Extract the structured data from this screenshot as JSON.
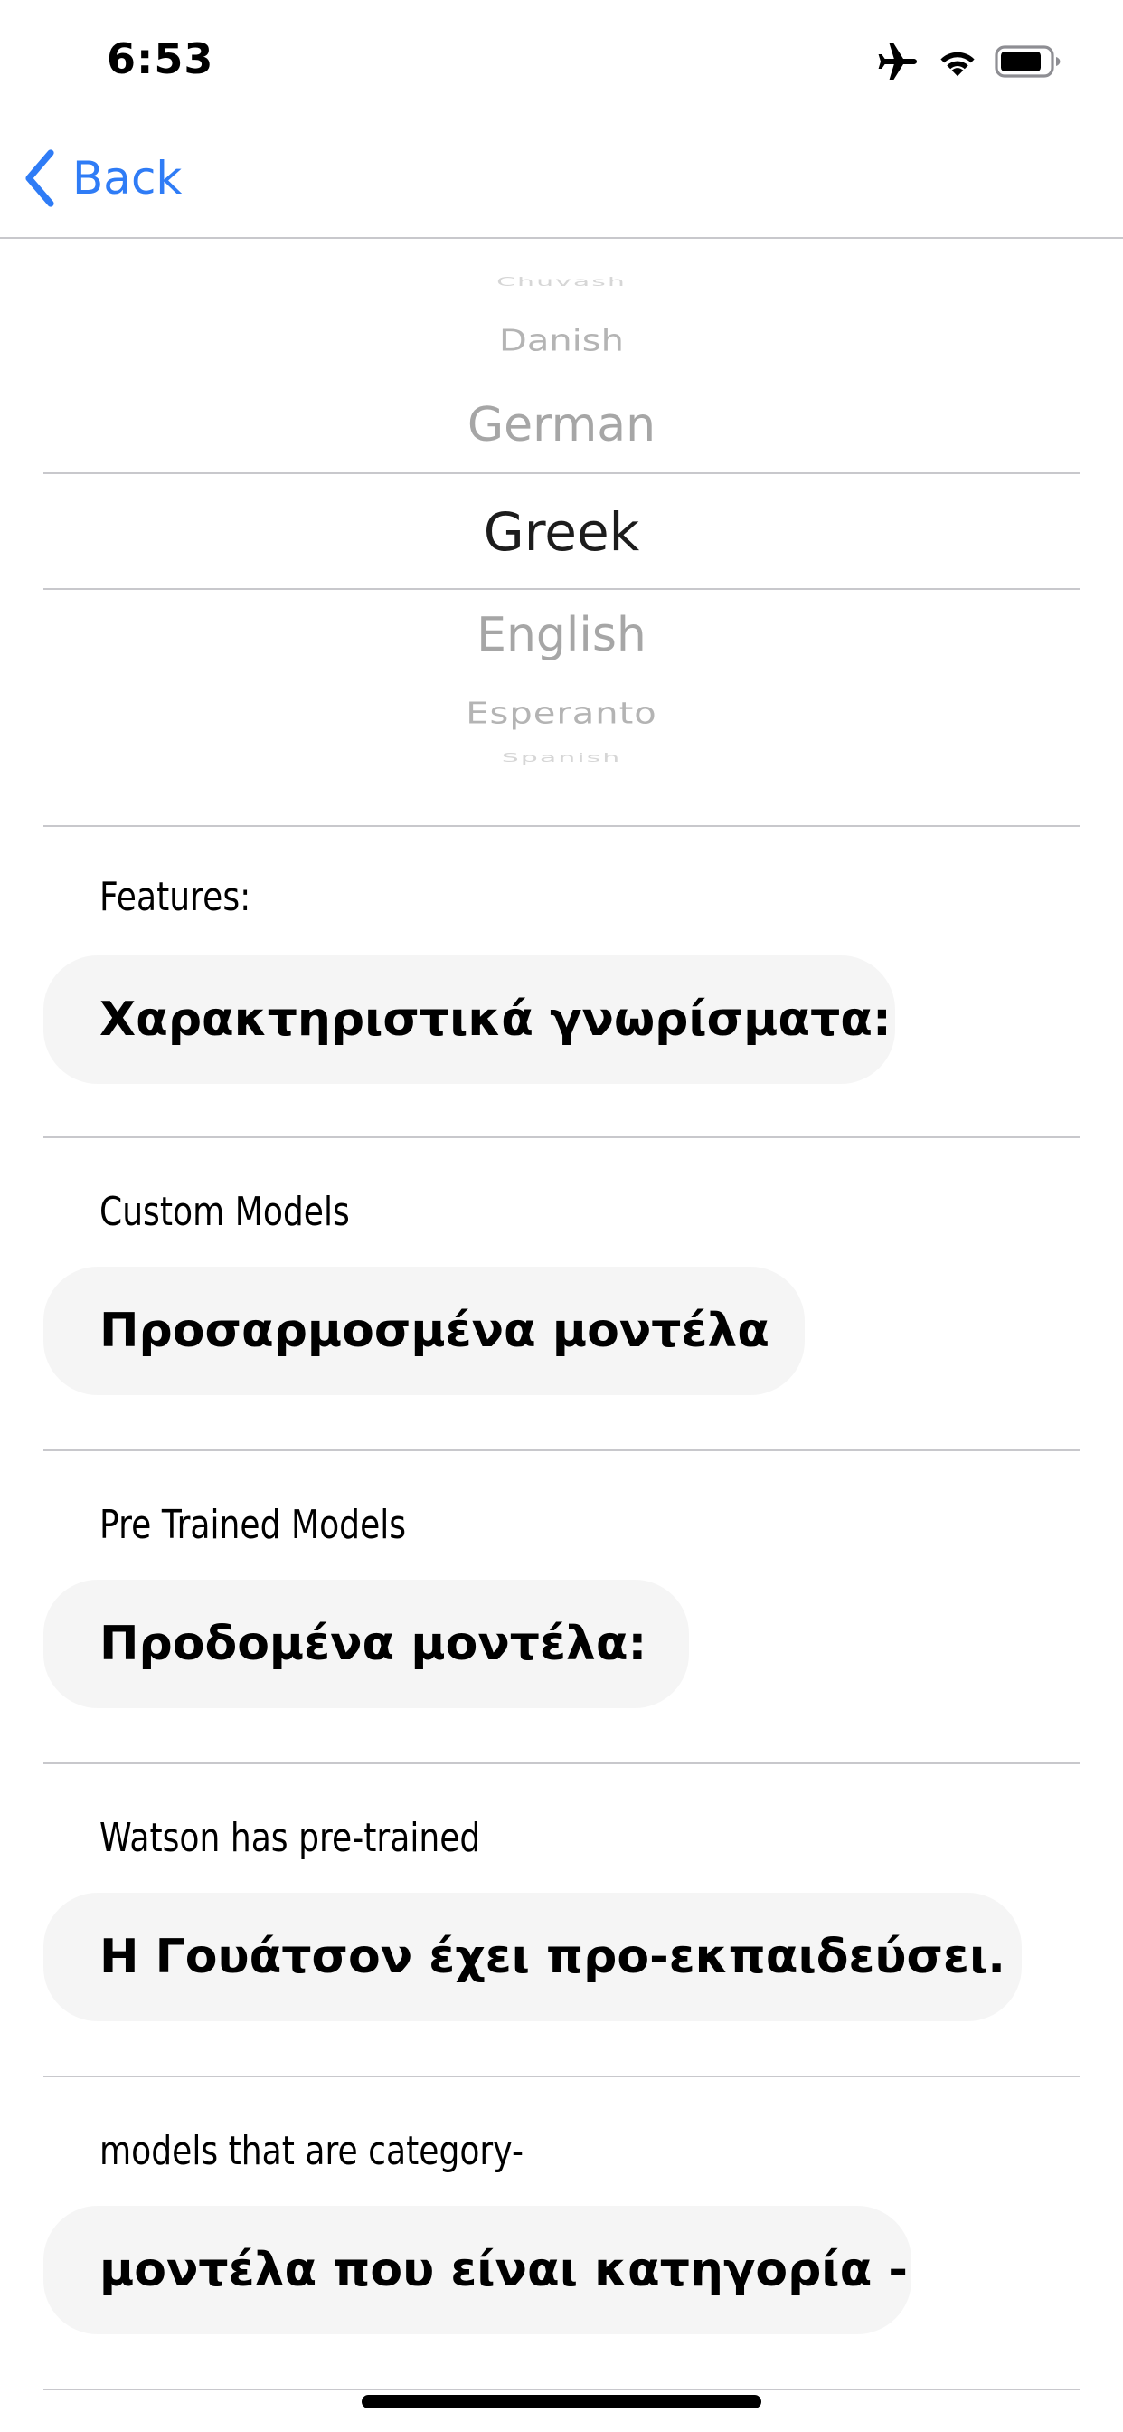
{
  "status_bar": {
    "time": "6:53",
    "icons": [
      "airplane-icon",
      "wifi-icon",
      "battery-icon"
    ]
  },
  "nav": {
    "back_label": "Back",
    "accent_color": "#2f7cf6"
  },
  "picker": {
    "items": [
      "Chuvash",
      "Danish",
      "German",
      "Greek",
      "English",
      "Esperanto",
      "Spanish"
    ],
    "selected": "Greek"
  },
  "sections": [
    {
      "label": "Features:",
      "translation": "Χαρακτηριστικά γνωρίσματα:"
    },
    {
      "label": "Custom Models",
      "translation": "Προσαρμοσμένα μοντέλα"
    },
    {
      "label": "Pre Trained Models",
      "translation": "Προδομένα μοντέλα:"
    },
    {
      "label": "Watson has pre-trained",
      "translation": "Η Γουάτσον έχει προ-εκπαιδεύσει."
    },
    {
      "label": "models that are category-",
      "translation": "μοντέλα που είναι κατηγορία -"
    }
  ]
}
